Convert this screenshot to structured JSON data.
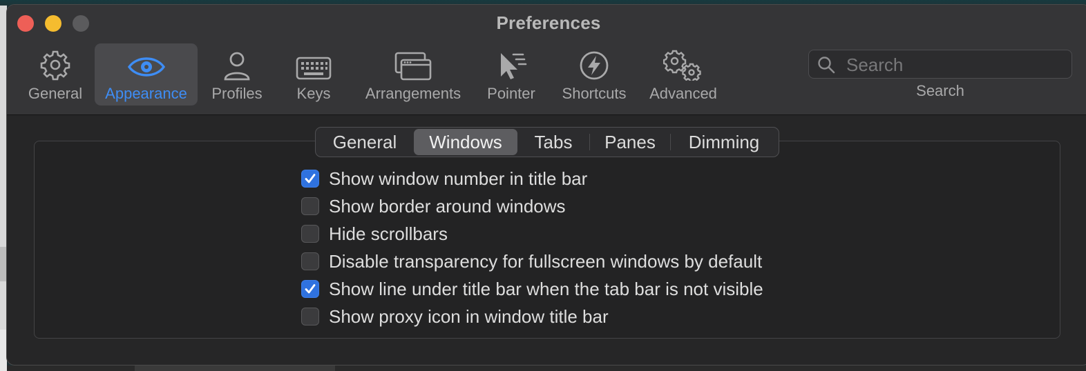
{
  "window": {
    "title": "Preferences"
  },
  "toolbar": {
    "items": [
      {
        "label": "General",
        "icon": "gear-icon"
      },
      {
        "label": "Appearance",
        "icon": "eye-icon",
        "active": true
      },
      {
        "label": "Profiles",
        "icon": "person-icon"
      },
      {
        "label": "Keys",
        "icon": "keyboard-icon"
      },
      {
        "label": "Arrangements",
        "icon": "windows-icon"
      },
      {
        "label": "Pointer",
        "icon": "cursor-icon"
      },
      {
        "label": "Shortcuts",
        "icon": "bolt-icon"
      },
      {
        "label": "Advanced",
        "icon": "gears-icon"
      }
    ],
    "search": {
      "placeholder": "Search",
      "label": "Search"
    }
  },
  "tabs": [
    {
      "label": "General"
    },
    {
      "label": "Windows",
      "selected": true
    },
    {
      "label": "Tabs"
    },
    {
      "label": "Panes"
    },
    {
      "label": "Dimming"
    }
  ],
  "options": [
    {
      "label": "Show window number in title bar",
      "checked": true
    },
    {
      "label": "Show border around windows",
      "checked": false
    },
    {
      "label": "Hide scrollbars",
      "checked": false
    },
    {
      "label": "Disable transparency for fullscreen windows by default",
      "checked": false
    },
    {
      "label": "Show line under title bar when the tab bar is not visible",
      "checked": true
    },
    {
      "label": "Show proxy icon in window title bar",
      "checked": false
    }
  ],
  "colors": {
    "accent": "#3e8df5",
    "checkbox_checked": "#2f72df",
    "close": "#ee5f57",
    "minimize": "#f5bc2f"
  }
}
